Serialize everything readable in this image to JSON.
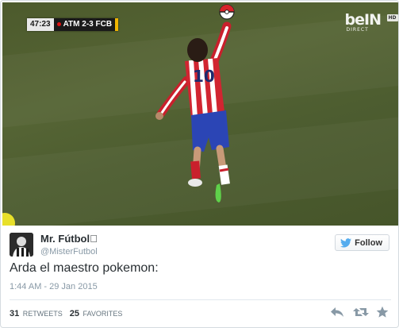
{
  "media": {
    "scorebug": {
      "clock": "47:23",
      "score": "ATM 2-3 FCB"
    },
    "channel": {
      "name": "beIN",
      "sub": "DIRECT",
      "hd": "HD"
    },
    "player_number": "10"
  },
  "tweet": {
    "author_name": "Mr. Fútbol\u0000",
    "author_handle": "@MisterFutbol",
    "follow_label": "Follow",
    "text": "Arda el maestro pokemon:",
    "timestamp": "1:44 AM - 29 Jan 2015",
    "retweets_count": "31",
    "retweets_label": "RETWEETS",
    "favorites_count": "25",
    "favorites_label": "FAVORITES"
  },
  "icons": {
    "follow": "twitter-bird-icon",
    "reply": "reply-icon",
    "retweet": "retweet-icon",
    "favorite": "star-icon"
  },
  "colors": {
    "twitter_blue": "#55acee",
    "action_gray": "#8899a6",
    "pitch_green": "#566535"
  }
}
